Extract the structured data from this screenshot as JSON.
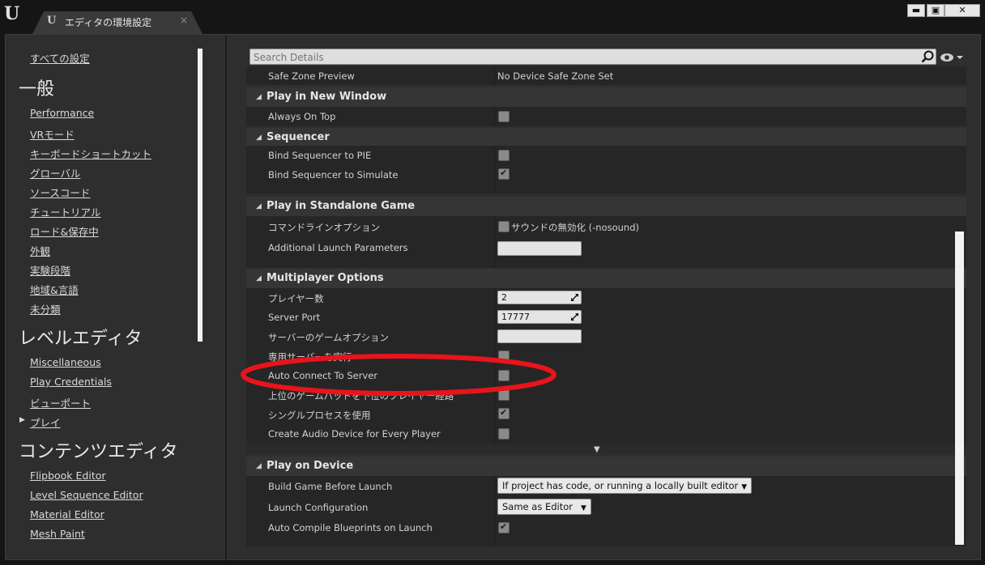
{
  "window": {
    "logo": "U",
    "tab_icon": "U",
    "tab_title": "エディタの環境設定",
    "tab_close": "×",
    "minimize": "▬",
    "maximize": "▣",
    "close": "✕"
  },
  "sidebar": {
    "all_settings": "すべての設定",
    "groups": [
      {
        "header": "一般",
        "items": [
          "Performance",
          "VRモード",
          "キーボードショートカット",
          "グローバル",
          "ソースコード",
          "チュートリアル",
          "ロード&保存中",
          "外観",
          "実験段階",
          "地域&言語",
          "未分類"
        ]
      },
      {
        "header": "レベルエディタ",
        "items": [
          "Miscellaneous",
          "Play Credentials",
          "ビューポート",
          "プレイ"
        ]
      },
      {
        "header": "コンテンツエディタ",
        "items": [
          "Flipbook Editor",
          "Level Sequence Editor",
          "Material Editor",
          "Mesh Paint"
        ]
      }
    ]
  },
  "search": {
    "placeholder": "Search Details"
  },
  "details": {
    "safe_zone": {
      "label": "Safe Zone Preview",
      "value": "No Device Safe Zone Set"
    },
    "sections": {
      "play_new_window": {
        "title": "Play in New Window",
        "always_on_top": "Always On Top"
      },
      "sequencer": {
        "title": "Sequencer",
        "bind_pie": "Bind Sequencer to PIE",
        "bind_sim": "Bind Sequencer to Simulate"
      },
      "standalone": {
        "title": "Play in Standalone Game",
        "cmd_options": "コマンドラインオプション",
        "nosound": "サウンドの無効化 (-nosound)",
        "additional": "Additional Launch Parameters"
      },
      "multiplayer": {
        "title": "Multiplayer Options",
        "players": "プレイヤー数",
        "players_value": "2",
        "server_port": "Server Port",
        "server_port_value": "17777",
        "server_game_options": "サーバーのゲームオプション",
        "dedicated": "専用サーバーを実行",
        "auto_connect": "Auto Connect To Server",
        "gamepad": "上位のゲームパッドを下位のプレイヤー経路",
        "single_process": "シングルプロセスを使用",
        "audio_device": "Create Audio Device for Every Player"
      },
      "device": {
        "title": "Play on Device",
        "build_game": "Build Game Before Launch",
        "build_game_value": "If project has code, or running a locally built editor",
        "launch_config": "Launch Configuration",
        "launch_config_value": "Same as Editor",
        "auto_compile": "Auto Compile Blueprints on Launch"
      }
    }
  },
  "checkboxes": {
    "always_on_top": false,
    "bind_pie": false,
    "bind_sim": true,
    "nosound": false,
    "dedicated": false,
    "auto_connect": false,
    "gamepad": false,
    "single_process": true,
    "audio_device": false,
    "auto_compile": true
  },
  "colors": {
    "highlight": "#e8141c",
    "background": "#2e2e2e"
  }
}
